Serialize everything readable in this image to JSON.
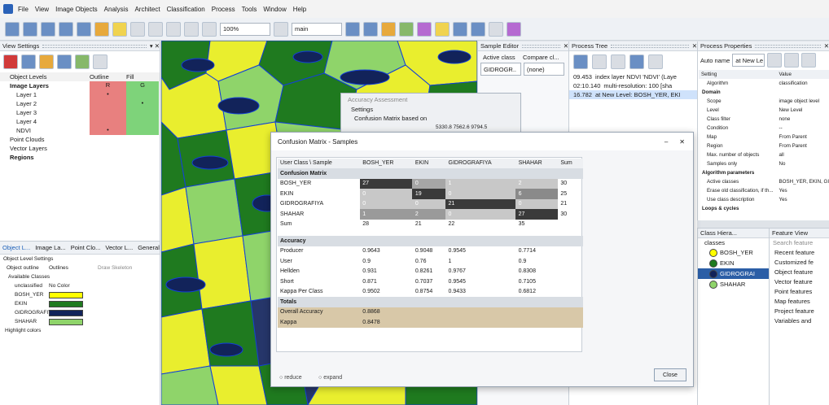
{
  "menu": [
    "File",
    "View",
    "Image Objects",
    "Analysis",
    "Architect",
    "Classification",
    "Process",
    "Tools",
    "Window",
    "Help"
  ],
  "toolbar": {
    "zoom": "100%",
    "layer": "main"
  },
  "view_settings": {
    "title": "View Settings",
    "columns": [
      "Object Levels",
      "Outline",
      "Fill"
    ],
    "image_layers_header": "Image Layers",
    "rg": [
      "R",
      "G"
    ],
    "layers": [
      "Layer 1",
      "Layer 2",
      "Layer 3",
      "Layer 4",
      "NDVI"
    ],
    "extras": [
      "Point Clouds",
      "Vector Layers",
      "Regions"
    ]
  },
  "bottom_tabs": [
    "Object L...",
    "Image La...",
    "Point Clo...",
    "Vector L...",
    "General ..."
  ],
  "object_level_settings": {
    "header": "Object Level Settings",
    "outline_label": "Object outline",
    "outline_value": "Outlines",
    "draw_skeleton": "Draw Skeleton",
    "available_classes": "Available Classes",
    "classes": [
      {
        "name": "unclassified",
        "value": "No Color",
        "color": ""
      },
      {
        "name": "BOSH_YER",
        "color": "#ffff00"
      },
      {
        "name": "EKIN",
        "color": "#1f7a1f"
      },
      {
        "name": "GIDROGRAFIYA",
        "color": "#12235a"
      },
      {
        "name": "SHAHAR",
        "color": "#8fd46a"
      }
    ],
    "highlight": "Highlight colors"
  },
  "sample_editor": {
    "title": "Sample Editor",
    "active_class_label": "Active class",
    "compare_label": "Compare cl...",
    "active_value": "GIDROGR..",
    "compare_value": "(none)"
  },
  "accuracy_assessment": {
    "title": "Accuracy Assessment",
    "settings": "Settings",
    "cm_based": "Confusion Matrix based on",
    "numbers": "5330.8 7562.6 9794.5"
  },
  "process_tree": {
    "title": "Process Tree",
    "items": [
      {
        "time": "09.453",
        "text": "index layer NDVI 'NDVI' (Laye"
      },
      {
        "time": "02:10.140",
        "text": "multi-resolution: 100 [sha"
      },
      {
        "time": "16.782",
        "text": "at New Level: BOSH_YER, EKI"
      }
    ]
  },
  "process_properties": {
    "title": "Process Properties",
    "auto_name": "Auto name",
    "auto_value": "at New Le",
    "columns": [
      "Setting",
      "Value"
    ],
    "rows": [
      {
        "k": "Algorithm",
        "v": "classification"
      },
      {
        "k": "Domain",
        "v": "",
        "section": true
      },
      {
        "k": "Scope",
        "v": "image object level"
      },
      {
        "k": "Level",
        "v": "New Level"
      },
      {
        "k": "Class filter",
        "v": "none"
      },
      {
        "k": "Condition",
        "v": "--"
      },
      {
        "k": "Map",
        "v": "From Parent"
      },
      {
        "k": "Region",
        "v": "From Parent"
      },
      {
        "k": "Max. number of objects",
        "v": "all"
      },
      {
        "k": "Samples only",
        "v": "No"
      },
      {
        "k": "Algorithm parameters",
        "v": "",
        "section": true
      },
      {
        "k": "Active classes",
        "v": "BOSH_YER, EKIN, GI.."
      },
      {
        "k": "Erase old classification, if th...",
        "v": "Yes"
      },
      {
        "k": "Use class description",
        "v": "Yes"
      },
      {
        "k": "Loops & cycles",
        "v": "",
        "section": true
      }
    ]
  },
  "class_hierarchy": {
    "title": "Class Hiera...",
    "root": "classes",
    "items": [
      {
        "name": "BOSH_YER",
        "color": "#ffff00"
      },
      {
        "name": "EKIN",
        "color": "#1f7a1f"
      },
      {
        "name": "GIDROGRAI",
        "color": "#12235a"
      },
      {
        "name": "SHAHAR",
        "color": "#8fd46a"
      }
    ]
  },
  "feature_view": {
    "title": "Feature View",
    "search": "Search feature",
    "items": [
      "Recent feature",
      "Customized fe",
      "Object feature",
      "Vector feature",
      "Point features",
      "Map features",
      "Project feature",
      "Variables and"
    ]
  },
  "confusion_matrix": {
    "title": "Confusion Matrix - Samples",
    "header": [
      "User Class \\ Sample",
      "BOSH_YER",
      "EKIN",
      "GIDROGRAFIYA",
      "SHAHAR",
      "Sum"
    ],
    "section1": "Confusion Matrix",
    "rows": [
      {
        "name": "BOSH_YER",
        "vals": [
          "27",
          "0",
          "1",
          "2"
        ],
        "sum": "30"
      },
      {
        "name": "EKIN",
        "vals": [
          "0",
          "19",
          "0",
          "6"
        ],
        "sum": "25"
      },
      {
        "name": "GIDROGRAFIYA",
        "vals": [
          "0",
          "0",
          "21",
          "0"
        ],
        "sum": "21"
      },
      {
        "name": "SHAHAR",
        "vals": [
          "1",
          "2",
          "0",
          "27"
        ],
        "sum": "30"
      }
    ],
    "sumrow": {
      "name": "Sum",
      "vals": [
        "28",
        "21",
        "22",
        "35"
      ]
    },
    "section2": "Accuracy",
    "accuracy": [
      {
        "name": "Producer",
        "vals": [
          "0.9643",
          "0.9048",
          "0.9545",
          "0.7714"
        ]
      },
      {
        "name": "User",
        "vals": [
          "0.9",
          "0.76",
          "1",
          "0.9"
        ]
      },
      {
        "name": "Hellden",
        "vals": [
          "0.931",
          "0.8261",
          "0.9767",
          "0.8308"
        ]
      },
      {
        "name": "Short",
        "vals": [
          "0.871",
          "0.7037",
          "0.9545",
          "0.7105"
        ]
      },
      {
        "name": "Kappa Per Class",
        "vals": [
          "0.9502",
          "0.8754",
          "0.9433",
          "0.6812"
        ]
      }
    ],
    "section3": "Totals",
    "totals": [
      {
        "name": "Overall Accuracy",
        "val": "0.8868"
      },
      {
        "name": "Kappa",
        "val": "0.8478"
      }
    ],
    "reduce": "reduce",
    "expand": "expand",
    "close": "Close"
  }
}
